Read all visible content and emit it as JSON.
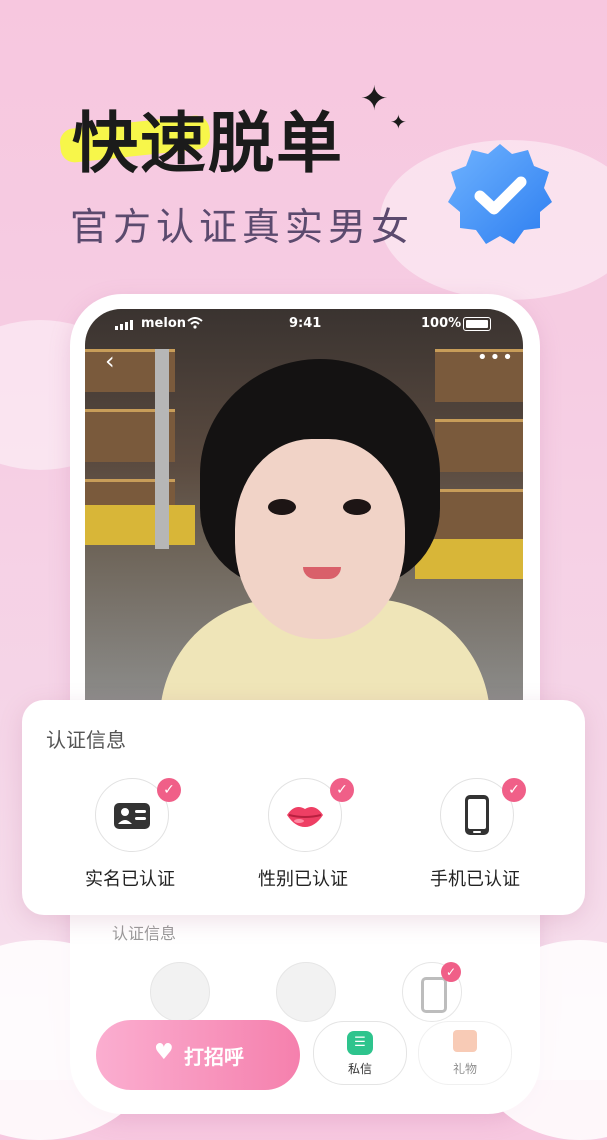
{
  "headline": "快速脱单",
  "subline": "官方认证真实男女",
  "status_bar": {
    "carrier": "melon",
    "time": "9:41",
    "battery": "100%"
  },
  "card": {
    "title": "认证信息",
    "items": [
      {
        "label": "实名已认证",
        "icon": "id-card-icon"
      },
      {
        "label": "性别已认证",
        "icon": "lips-icon"
      },
      {
        "label": "手机已认证",
        "icon": "phone-icon"
      }
    ]
  },
  "faint": {
    "title": "认证信息"
  },
  "bottom_bar": {
    "greet_label": "打招呼",
    "message_label": "私信",
    "gift_label": "礼物"
  },
  "colors": {
    "accent": "#f05f88",
    "highlight": "#f7f64a",
    "badge_blue": "#3b8df5"
  }
}
